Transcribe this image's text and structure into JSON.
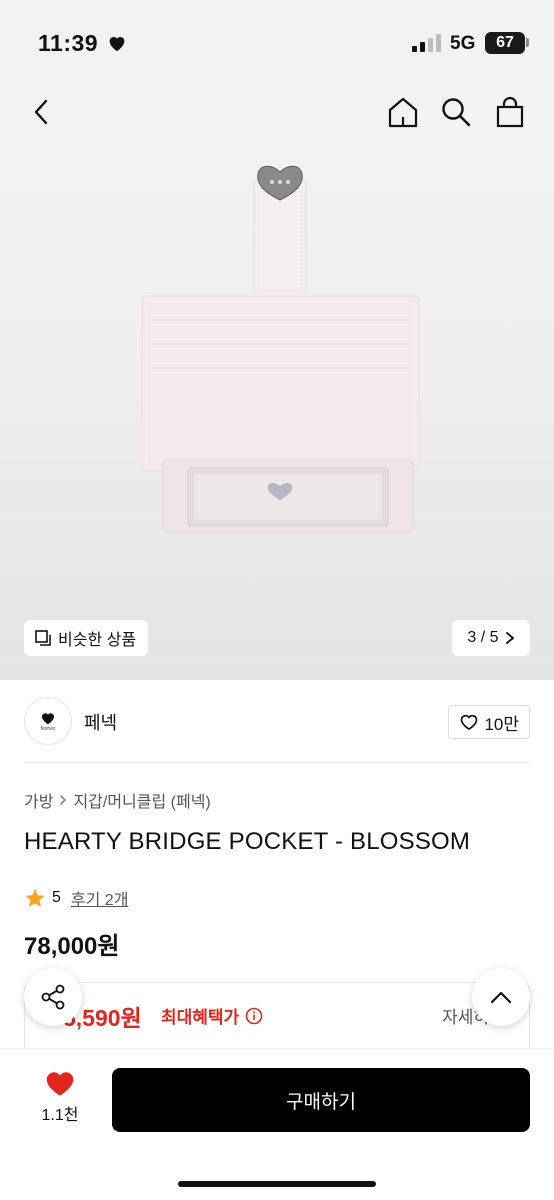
{
  "status": {
    "time": "11:39",
    "network": "5G",
    "battery": "67"
  },
  "hero": {
    "image_alt": "HEARTY BRIDGE POCKET card wallet in blossom pink",
    "similar_label": "비슷한 상품",
    "pager": "3 / 5"
  },
  "brand": {
    "name": "페넥",
    "logo_text": "fennec",
    "like_count": "10만"
  },
  "breadcrumb": {
    "level1": "가방",
    "level2": "지갑/머니클립 (페넥)"
  },
  "product": {
    "title": "HEARTY BRIDGE POCKET - BLOSSOM",
    "rating": "5",
    "reviews": "후기 2개",
    "price": "78,000원"
  },
  "benefit": {
    "price": "5,590원",
    "label": "최대혜택가",
    "detail": "자세히"
  },
  "bottom": {
    "wish_count": "1.1천",
    "buy_label": "구매하기"
  },
  "colors": {
    "accent_red": "#e0261d",
    "star": "#f5a623",
    "buy_button": "#000000"
  }
}
